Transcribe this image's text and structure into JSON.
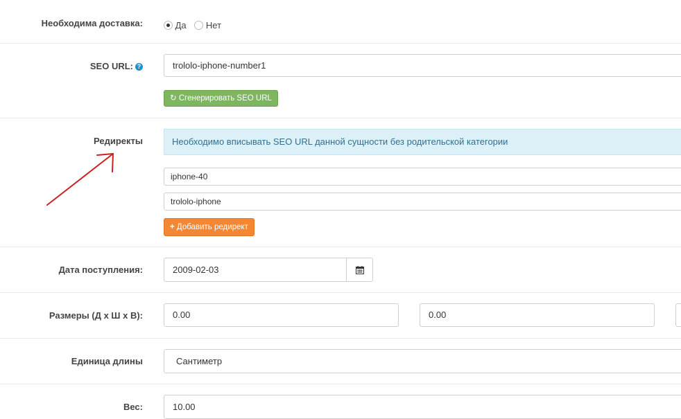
{
  "shipping": {
    "label": "Необходима доставка:",
    "options": [
      {
        "label": "Да",
        "selected": true
      },
      {
        "label": "Нет",
        "selected": false
      }
    ]
  },
  "seo": {
    "label": "SEO URL:",
    "help_icon": "question-circle-icon",
    "value": "trololo-iphone-number1",
    "generate_label": "Сгенерировать SEO URL"
  },
  "redirects": {
    "label": "Редиректы",
    "notice": "Необходимо вписывать SEO URL данной сущности без родительской категории",
    "items": [
      "iphone-40",
      "trololo-iphone"
    ],
    "add_label": "Добавить редирект"
  },
  "arrival": {
    "label": "Дата поступления:",
    "value": "2009-02-03",
    "icon": "calendar-icon"
  },
  "dimensions": {
    "label": "Размеры (Д х Ш х В):",
    "length": "0.00",
    "width": "0.00"
  },
  "length_unit": {
    "label": "Единица длины",
    "value": "Сантиметр"
  },
  "weight": {
    "label": "Вес:",
    "value": "10.00"
  },
  "colors": {
    "annotation_arrow": "#cc1f1f",
    "success": "#7db561",
    "warning": "#f38733",
    "info_bg": "#dcf0f8"
  }
}
